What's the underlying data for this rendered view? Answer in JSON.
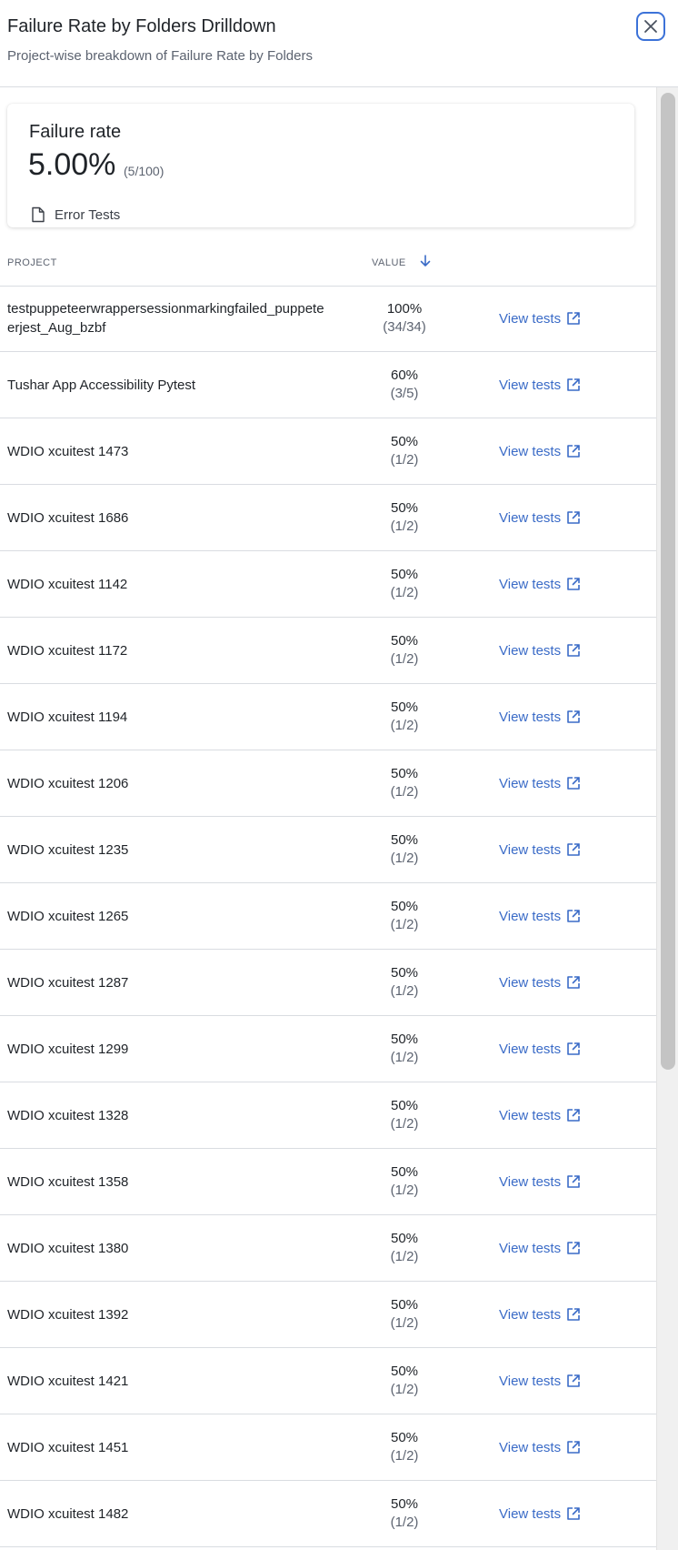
{
  "header": {
    "title": "Failure Rate by Folders Drilldown",
    "subtitle": "Project-wise breakdown of Failure Rate by Folders",
    "close_icon": "close-icon",
    "accent_color": "#3c72d8"
  },
  "summary": {
    "title": "Failure rate",
    "value": "5.00%",
    "ratio": "(5/100)",
    "link_label": "Error Tests",
    "link_icon": "document-icon"
  },
  "table": {
    "columns": {
      "project": "PROJECT",
      "value": "VALUE"
    },
    "sort_icon": "arrow-down-icon",
    "link_icon": "external-link-icon",
    "link_color": "#3a6bc7",
    "rows": [
      {
        "project": "testpuppeteerwrappersessionmarkingfailed_puppeteerjest_Aug_bzbf",
        "percent": "100%",
        "ratio": "(34/34)",
        "link": "View tests"
      },
      {
        "project": "Tushar App Accessibility Pytest",
        "percent": "60%",
        "ratio": "(3/5)",
        "link": "View tests"
      },
      {
        "project": "WDIO xcuitest 1473",
        "percent": "50%",
        "ratio": "(1/2)",
        "link": "View tests"
      },
      {
        "project": "WDIO xcuitest 1686",
        "percent": "50%",
        "ratio": "(1/2)",
        "link": "View tests"
      },
      {
        "project": "WDIO xcuitest 1142",
        "percent": "50%",
        "ratio": "(1/2)",
        "link": "View tests"
      },
      {
        "project": "WDIO xcuitest 1172",
        "percent": "50%",
        "ratio": "(1/2)",
        "link": "View tests"
      },
      {
        "project": "WDIO xcuitest 1194",
        "percent": "50%",
        "ratio": "(1/2)",
        "link": "View tests"
      },
      {
        "project": "WDIO xcuitest 1206",
        "percent": "50%",
        "ratio": "(1/2)",
        "link": "View tests"
      },
      {
        "project": "WDIO xcuitest 1235",
        "percent": "50%",
        "ratio": "(1/2)",
        "link": "View tests"
      },
      {
        "project": "WDIO xcuitest 1265",
        "percent": "50%",
        "ratio": "(1/2)",
        "link": "View tests"
      },
      {
        "project": "WDIO xcuitest 1287",
        "percent": "50%",
        "ratio": "(1/2)",
        "link": "View tests"
      },
      {
        "project": "WDIO xcuitest 1299",
        "percent": "50%",
        "ratio": "(1/2)",
        "link": "View tests"
      },
      {
        "project": "WDIO xcuitest 1328",
        "percent": "50%",
        "ratio": "(1/2)",
        "link": "View tests"
      },
      {
        "project": "WDIO xcuitest 1358",
        "percent": "50%",
        "ratio": "(1/2)",
        "link": "View tests"
      },
      {
        "project": "WDIO xcuitest 1380",
        "percent": "50%",
        "ratio": "(1/2)",
        "link": "View tests"
      },
      {
        "project": "WDIO xcuitest 1392",
        "percent": "50%",
        "ratio": "(1/2)",
        "link": "View tests"
      },
      {
        "project": "WDIO xcuitest 1421",
        "percent": "50%",
        "ratio": "(1/2)",
        "link": "View tests"
      },
      {
        "project": "WDIO xcuitest 1451",
        "percent": "50%",
        "ratio": "(1/2)",
        "link": "View tests"
      },
      {
        "project": "WDIO xcuitest 1482",
        "percent": "50%",
        "ratio": "(1/2)",
        "link": "View tests"
      }
    ]
  }
}
